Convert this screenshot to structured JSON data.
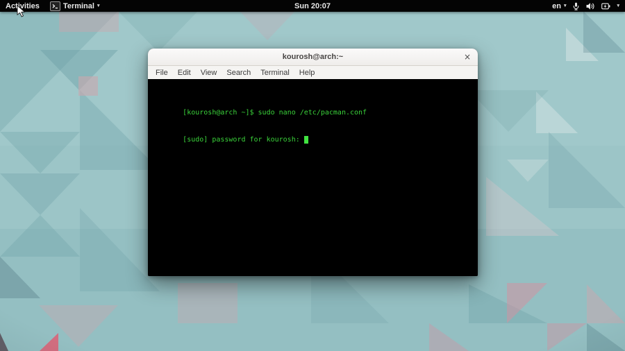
{
  "topbar": {
    "activities": "Activities",
    "app_menu_label": "Terminal",
    "app_menu_caret": "▾",
    "clock": "Sun 20:07",
    "keyboard_layout": "en",
    "keyboard_caret": "▾",
    "system_caret": "▾",
    "status_icons": [
      "microphone-icon",
      "volume-icon",
      "battery-icon"
    ]
  },
  "window": {
    "title": "kourosh@arch:~",
    "close": "×",
    "menu": [
      "File",
      "Edit",
      "View",
      "Search",
      "Terminal",
      "Help"
    ],
    "terminal": {
      "line1": "[kourosh@arch ~]$ sudo nano /etc/pacman.conf",
      "line2": "[sudo] password for kourosh: "
    }
  },
  "colors": {
    "topbar_bg": "#040404",
    "titlebar_bg": "#f5f3f1",
    "terminal_bg": "#000000",
    "terminal_text": "#3ad23a",
    "terminal_cursor": "#41e341",
    "wallpaper_base": "#9cc4c6",
    "wallpaper_dark_teal": "#679ca2",
    "wallpaper_pink": "#c9a7ae",
    "wallpaper_red": "#dd5f74"
  }
}
